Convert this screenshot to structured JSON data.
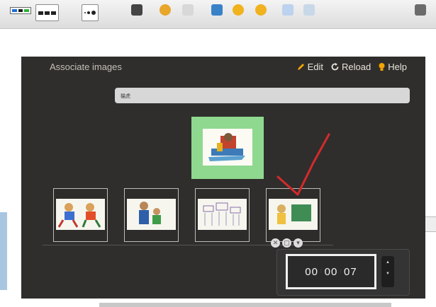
{
  "panel": {
    "title": "Associate images",
    "actions": [
      {
        "label": "Edit"
      },
      {
        "label": "Reload"
      },
      {
        "label": "Help"
      }
    ],
    "search_value": "猫虎"
  },
  "timer": {
    "hours": "00",
    "minutes": "00",
    "seconds": "07"
  },
  "colors": {
    "panel_bg": "#2f2e2c",
    "target_bg": "#8fd88f",
    "check_mark": "#d42a2a",
    "help_icon": "#f2a400"
  }
}
